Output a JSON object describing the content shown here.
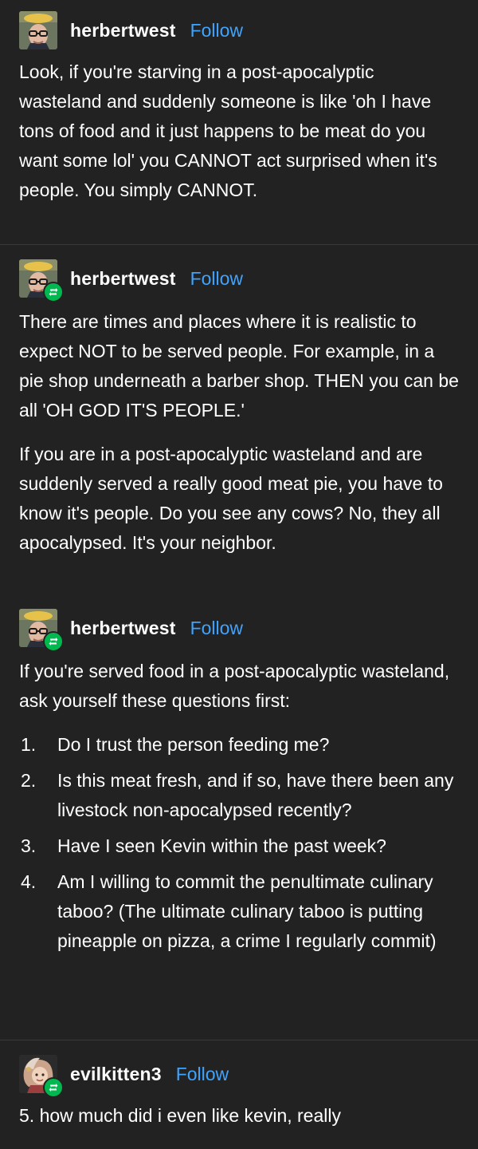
{
  "theme": {
    "background": "#222222",
    "text": "#ffffff",
    "link": "#3ea4ff",
    "reblog_badge": "#00b84f",
    "divider": "#3a3a3a"
  },
  "posts": [
    {
      "username": "herbertwest",
      "follow_label": "Follow",
      "is_reblog": false,
      "paragraphs": [
        "Look, if you're starving in a post-apocalyptic wasteland and suddenly someone is like 'oh I have tons of food and it just happens to be meat do you want some lol' you CANNOT act surprised when it's people. You simply CANNOT."
      ]
    },
    {
      "username": "herbertwest",
      "follow_label": "Follow",
      "is_reblog": true,
      "paragraphs": [
        "There are times and places where it is realistic to expect NOT to be served people. For example, in a pie shop underneath a barber shop. THEN you can be all 'OH GOD IT'S PEOPLE.'",
        "If you are in a post-apocalyptic wasteland and are suddenly served a really good meat pie, you have to know it's people. Do you see any cows? No, they all apocalypsed. It's your neighbor."
      ]
    },
    {
      "username": "herbertwest",
      "follow_label": "Follow",
      "is_reblog": true,
      "paragraphs": [
        "If you're served food in a post-apocalyptic wasteland, ask yourself these questions first:"
      ],
      "list": [
        {
          "num": "1.",
          "text": "Do I trust the person feeding me?"
        },
        {
          "num": "2.",
          "text": "Is this meat fresh, and if so, have there been any livestock non-apocalypsed recently?"
        },
        {
          "num": "3.",
          "text": "Have I seen Kevin within the past week?"
        },
        {
          "num": "4.",
          "text": "Am I willing to commit the penultimate culinary taboo? (The ultimate culinary taboo is putting pineapple on pizza, a crime I regularly commit)"
        }
      ]
    },
    {
      "username": "evilkitten3",
      "follow_label": "Follow",
      "is_reblog": true,
      "paragraphs": [
        "5. how much did i even like kevin, really"
      ]
    }
  ],
  "icons": {
    "reblog": "reblog-icon",
    "avatar_herbert": "herbertwest-avatar",
    "avatar_evilkitten": "evilkitten3-avatar"
  }
}
